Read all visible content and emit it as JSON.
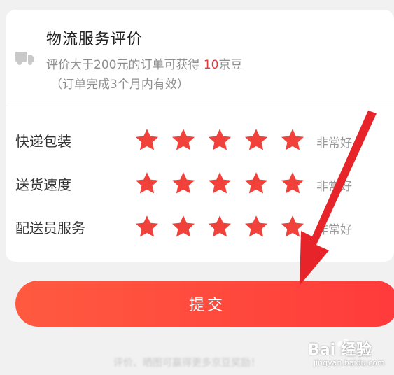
{
  "section": {
    "title": "物流服务评价",
    "subtitle_prefix": "评价大于200元的订单可获得 ",
    "subtitle_amount": "10",
    "subtitle_suffix": "京豆",
    "subtitle_note": "（订单完成3个月内有效）"
  },
  "ratings": [
    {
      "label": "快递包装",
      "stars": 5,
      "max": 5,
      "text": "非常好"
    },
    {
      "label": "送货速度",
      "stars": 5,
      "max": 5,
      "text": "非常好"
    },
    {
      "label": "配送员服务",
      "stars": 5,
      "max": 5,
      "text": "非常好"
    }
  ],
  "submit_label": "提交",
  "footer_hint": "评价、晒图可赢得更多京豆奖励！",
  "watermark": {
    "text": "Bai 经验",
    "url": "jingyan.baidu.com"
  },
  "colors": {
    "star": "#f0413a",
    "accent": "#e4393c",
    "button": "#ff4a3d",
    "arrow": "#e8242b"
  },
  "icons": {
    "truck": "truck-icon",
    "star": "star-icon"
  }
}
